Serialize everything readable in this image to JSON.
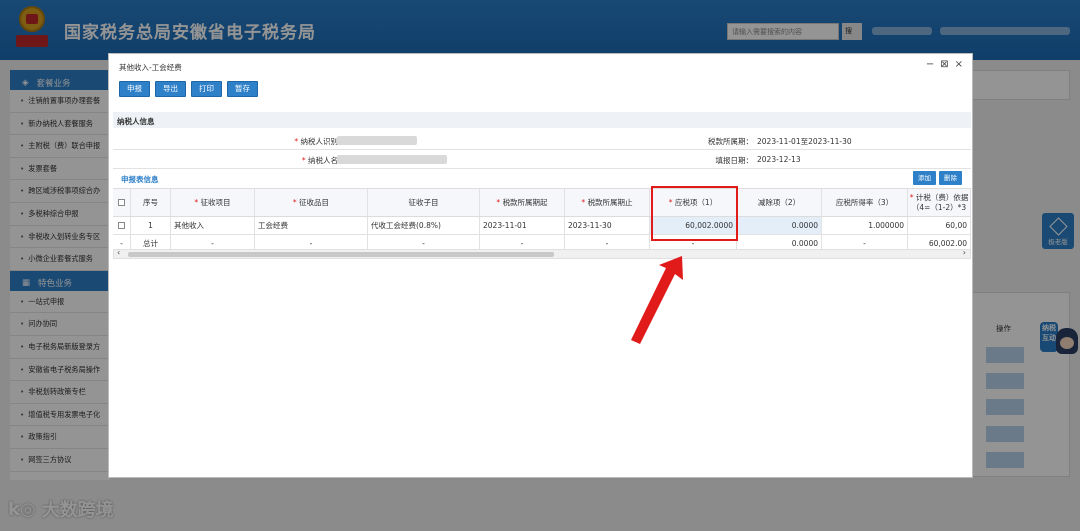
{
  "header": {
    "site_title": "国家税务总局安徽省电子税务局",
    "search_placeholder": "请输入需要搜索的内容",
    "search_button": "搜"
  },
  "sidebar": {
    "sections": [
      {
        "title": "套餐业务",
        "items": [
          "注销前置事项办理套餐",
          "新办纳税人套餐服务",
          "主附税（费）联合申报",
          "发票套餐",
          "跨区域涉税事项综合办",
          "多税种综合申报",
          "非税收入划转业务专区",
          "小微企业套餐式服务"
        ]
      },
      {
        "title": "特色业务",
        "items": [
          "一站式申报",
          "问办协同",
          "电子税务局新版登录方",
          "安徽省电子税务局操作",
          "非税划转政策专栏",
          "增值税专用发票电子化",
          "政策指引",
          "网签三方协议"
        ]
      }
    ]
  },
  "right_panel": {
    "operation_header": "操作",
    "float_button": "极老版",
    "mascot_text": "纳税互动"
  },
  "watermark": {
    "logo": "k◎",
    "text": "大数跨境"
  },
  "dialog": {
    "title": "其他收入-工会经费",
    "controls": {
      "minimize": "−",
      "maximize": "⊠",
      "close": "×"
    },
    "toolbar": {
      "declare": "申报",
      "export": "导出",
      "print": "打印",
      "save": "暂存"
    },
    "taxpayer_section": "纳税人信息",
    "taxpayer": {
      "id_label": "纳税人识别号：",
      "name_label": "纳税人名称：",
      "period_label": "税款所属期：",
      "period_value": "2023-11-01至2023-11-30",
      "fill_date_label": "填报日期：",
      "fill_date_value": "2023-12-13"
    },
    "declaration_section": "申报表信息",
    "add_button": "添加",
    "delete_button": "删除",
    "table": {
      "headers": [
        "序号",
        "征收项目",
        "征收品目",
        "征收子目",
        "税款所属期起",
        "税款所属期止",
        "应税项（1）",
        "减除项（2）",
        "应税所得率（3）",
        "计税（费）依据",
        "（4=（1-2）*3"
      ],
      "required_cols": [
        1,
        2,
        4,
        5,
        6,
        9
      ],
      "rows": [
        {
          "seq": "1",
          "project": "其他收入",
          "item": "工会经费",
          "subitem": "代收工会经费(0.8%)",
          "start": "2023-11-01",
          "end": "2023-11-30",
          "taxable": "60,002.0000",
          "deduct": "0.0000",
          "rate": "1.000000",
          "basis": "60,00"
        }
      ],
      "total": {
        "label": "总计",
        "dash": "-",
        "taxable": "-",
        "deduct": "0.0000",
        "rate": "-",
        "basis": "60,002.00"
      }
    }
  }
}
